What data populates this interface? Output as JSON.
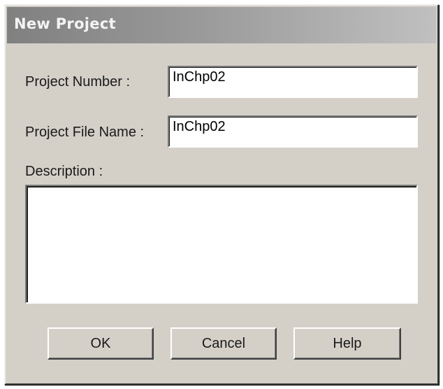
{
  "window": {
    "title": "New Project"
  },
  "form": {
    "project_number_label": "Project Number :",
    "project_number_value": "InChp02",
    "project_file_name_label": "Project File Name :",
    "project_file_name_value": "InChp02",
    "description_label": "Description :",
    "description_value": ""
  },
  "buttons": {
    "ok_label": "OK",
    "cancel_label": "Cancel",
    "help_label": "Help"
  }
}
